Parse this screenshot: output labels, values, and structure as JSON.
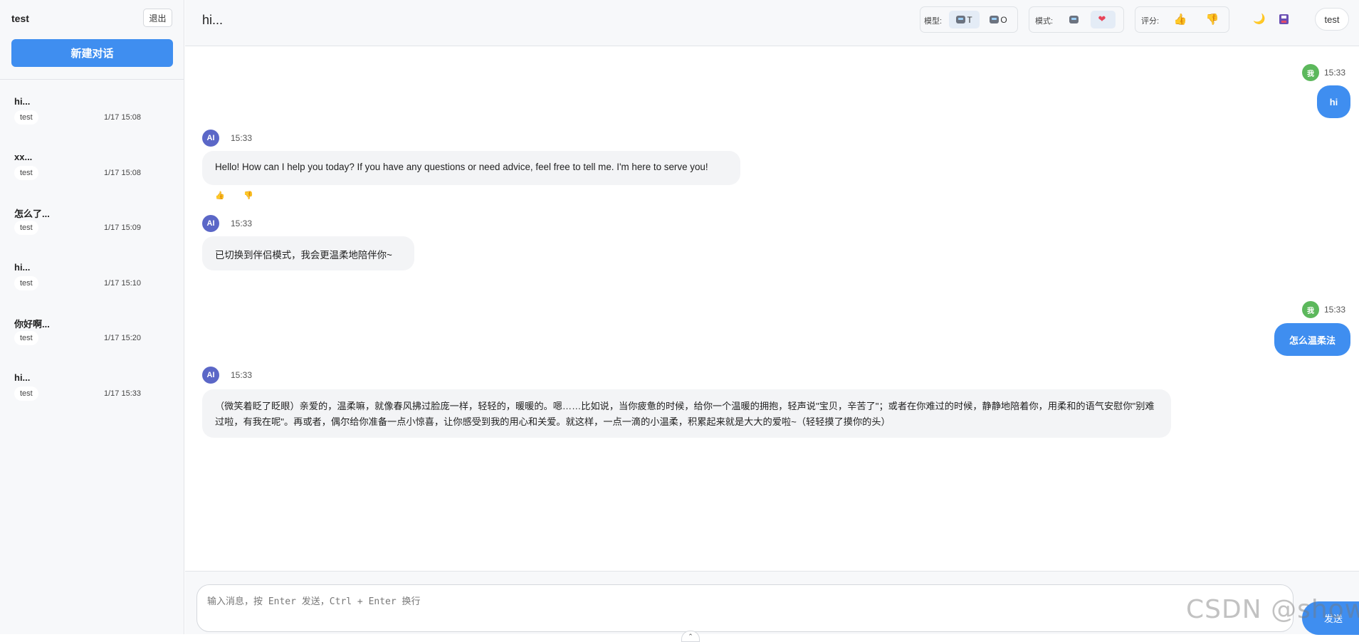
{
  "sidebar": {
    "username": "test",
    "logout_label": "退出",
    "new_chat_label": "新建对话",
    "conversations": [
      {
        "title": "hi...",
        "tag": "test",
        "time": "1/17 15:08"
      },
      {
        "title": "xx...",
        "tag": "test",
        "time": "1/17 15:08"
      },
      {
        "title": "怎么了...",
        "tag": "test",
        "time": "1/17 15:09"
      },
      {
        "title": "hi...",
        "tag": "test",
        "time": "1/17 15:10"
      },
      {
        "title": "你好啊...",
        "tag": "test",
        "time": "1/17 15:20"
      },
      {
        "title": "hi...",
        "tag": "test",
        "time": "1/17 15:33"
      }
    ]
  },
  "header": {
    "title": "hi...",
    "model_label": "模型:",
    "model_options": [
      {
        "label": "T",
        "icon": "robot-icon",
        "active": true
      },
      {
        "label": "O",
        "icon": "robot-icon",
        "active": false
      }
    ],
    "mode_label": "模式:",
    "mode_options": [
      {
        "icon": "robot-icon",
        "active": false
      },
      {
        "icon": "heart-icon",
        "active": true
      }
    ],
    "rating_label": "评分:",
    "user": "test"
  },
  "messages": [
    {
      "role": "user",
      "avatar": "我",
      "time": "15:33",
      "text": "hi"
    },
    {
      "role": "ai",
      "avatar": "AI",
      "time": "15:33",
      "text": "Hello! How can I help you today? If you have any questions or need advice, feel free to tell me. I'm here to serve you!"
    },
    {
      "role": "ai",
      "avatar": "AI",
      "time": "15:33",
      "text": "已切换到伴侣模式，我会更温柔地陪伴你~"
    },
    {
      "role": "user",
      "avatar": "我",
      "time": "15:33",
      "text": "怎么温柔法"
    },
    {
      "role": "ai",
      "avatar": "AI",
      "time": "15:33",
      "text": "（微笑着眨了眨眼）亲爱的，温柔嘛，就像春风拂过脸庞一样，轻轻的，暖暖的。嗯……比如说，当你疲惫的时候，给你一个温暖的拥抱，轻声说\"宝贝，辛苦了\"；或者在你难过的时候，静静地陪着你，用柔和的语气安慰你\"别难过啦，有我在呢\"。再或者，偶尔给你准备一点小惊喜，让你感受到我的用心和关爱。就这样，一点一滴的小温柔，积累起来就是大大的爱啦~（轻轻摸了摸你的头）"
    }
  ],
  "input": {
    "placeholder": "输入消息，按 Enter 发送，Ctrl + Enter 换行",
    "value": "",
    "send_label": "发送"
  },
  "watermark": "CSDN @showx",
  "colors": {
    "accent": "#3f8ef0",
    "ai_avatar": "#5b67c7",
    "user_avatar": "#5cb85c"
  }
}
